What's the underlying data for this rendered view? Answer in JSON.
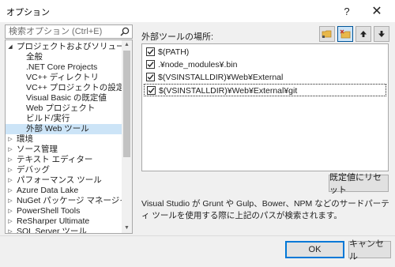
{
  "window": {
    "title": "オプション",
    "help_glyph": "?",
    "close_glyph": "✕"
  },
  "search": {
    "placeholder": "検索オプション (Ctrl+E)"
  },
  "tree": {
    "items": [
      {
        "label": "プロジェクトおよびソリューション",
        "expanded": true,
        "has_children": true,
        "level": 0
      },
      {
        "label": "全般",
        "level": 1
      },
      {
        "label": ".NET Core Projects",
        "level": 1
      },
      {
        "label": "VC++ ディレクトリ",
        "level": 1
      },
      {
        "label": "VC++ プロジェクトの設定",
        "level": 1
      },
      {
        "label": "Visual Basic の既定値",
        "level": 1
      },
      {
        "label": "Web プロジェクト",
        "level": 1
      },
      {
        "label": "ビルド/実行",
        "level": 1
      },
      {
        "label": "外部 Web ツール",
        "level": 1,
        "selected": true
      },
      {
        "label": "環境",
        "has_children": true,
        "level": 0
      },
      {
        "label": "ソース管理",
        "has_children": true,
        "level": 0
      },
      {
        "label": "テキスト エディター",
        "has_children": true,
        "level": 0
      },
      {
        "label": "デバッグ",
        "has_children": true,
        "level": 0
      },
      {
        "label": "パフォーマンス ツール",
        "has_children": true,
        "level": 0
      },
      {
        "label": "Azure Data Lake",
        "has_children": true,
        "level": 0
      },
      {
        "label": "NuGet パッケージ マネージャー",
        "has_children": true,
        "level": 0
      },
      {
        "label": "PowerShell Tools",
        "has_children": true,
        "level": 0
      },
      {
        "label": "ReSharper Ultimate",
        "has_children": true,
        "level": 0
      },
      {
        "label": "SQL Server ツール",
        "has_children": true,
        "level": 0
      }
    ]
  },
  "panel": {
    "section_label": "外部ツールの場所:",
    "paths": [
      {
        "label": "$(PATH)",
        "checked": true
      },
      {
        "label": ".¥node_modules¥.bin",
        "checked": true
      },
      {
        "label": "$(VSINSTALLDIR)¥Web¥External",
        "checked": true
      },
      {
        "label": "$(VSINSTALLDIR)¥Web¥External¥git",
        "checked": true,
        "selected": true
      }
    ],
    "reset_label": "既定値にリセット",
    "description": "Visual Studio が Grunt や Gulp、Bower、NPM などのサードパーティ ツールを使用する際に上記のパスが検索されます。"
  },
  "footer": {
    "ok_label": "OK",
    "cancel_label": "キャンセル"
  },
  "colors": {
    "selection": "#cce4f7",
    "accent": "#0078d7",
    "folder": "#e8b84a"
  }
}
